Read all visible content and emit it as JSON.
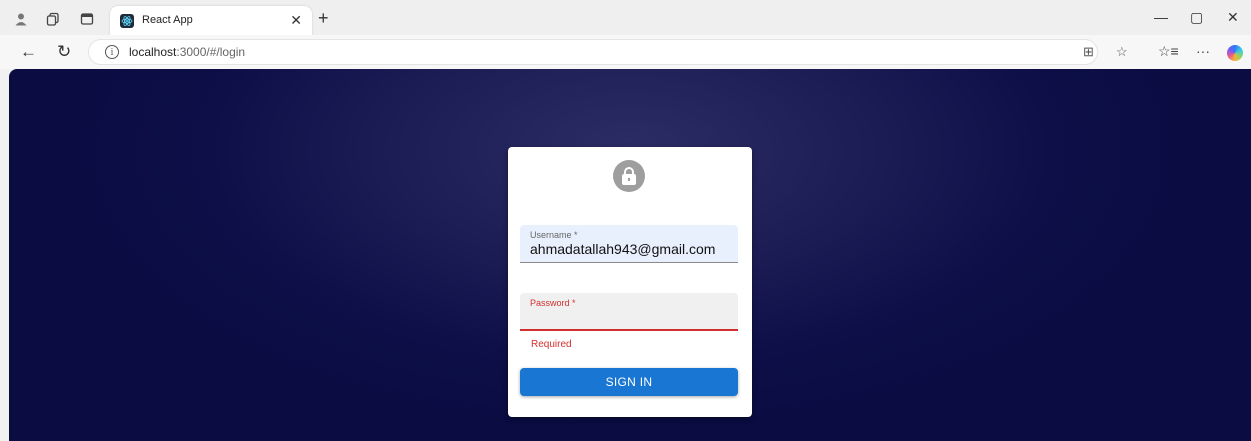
{
  "browser": {
    "tab": {
      "title": "React App",
      "favicon": "react-logo-icon",
      "close_glyph": "✕"
    },
    "new_tab_glyph": "+",
    "window_controls": {
      "minimize": "—",
      "restore": "▢",
      "close": "✕"
    },
    "nav": {
      "back": "←",
      "refresh": "↻"
    },
    "address": {
      "info_glyph": "i",
      "host": "localhost",
      "path": ":3000/#/login"
    },
    "toolbar_glyphs": {
      "split_screen": "⊞",
      "favorite": "☆",
      "favorites_list": "☆≡",
      "more": "···"
    }
  },
  "login": {
    "username": {
      "label": "Username *",
      "value": "ahmadatallah943@gmail.com"
    },
    "password": {
      "label": "Password *",
      "value": "",
      "helper": "Required"
    },
    "submit_label": "SIGN IN"
  },
  "colors": {
    "background_dark": "#0a0c42",
    "background_center": "#2c2d64",
    "primary": "#1976d2",
    "error": "#d32f2f",
    "autofill": "#e8f0fe"
  }
}
